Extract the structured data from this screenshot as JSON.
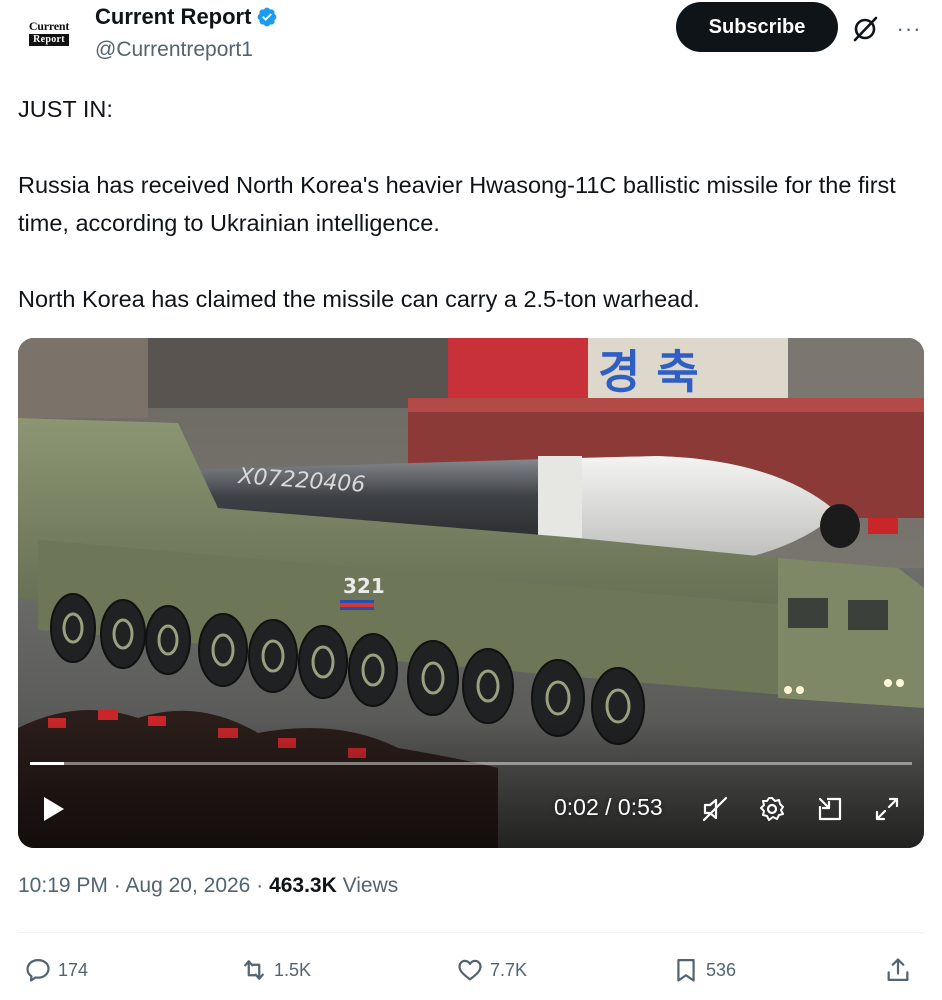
{
  "account": {
    "avatar_line1": "Current",
    "avatar_line2": "Report",
    "display_name": "Current Report",
    "handle": "@Currentreport1"
  },
  "header": {
    "subscribe_label": "Subscribe",
    "more_label": "···"
  },
  "tweet": {
    "paragraphs": [
      "JUST IN:",
      "Russia has received North Korea's heavier Hwasong-11C ballistic missile for the first time, according to Ukrainian intelligence.",
      "North Korea has claimed the missile can carry a 2.5-ton warhead."
    ]
  },
  "video": {
    "missile_marking": "X07220406",
    "vehicle_number": "321",
    "banner_text": "경 축",
    "time_display": "0:02 / 0:53",
    "progress_fraction": 0.038
  },
  "meta": {
    "time": "10:19 PM",
    "date": "Aug 20, 2026",
    "views_count": "463.3K",
    "views_label": "Views",
    "sep": "·"
  },
  "actions": {
    "replies": "174",
    "reposts": "1.5K",
    "likes": "7.7K",
    "bookmarks": "536"
  },
  "colors": {
    "verified": "#1d9bf0",
    "text": "#0f1419",
    "secondary": "#536471"
  }
}
